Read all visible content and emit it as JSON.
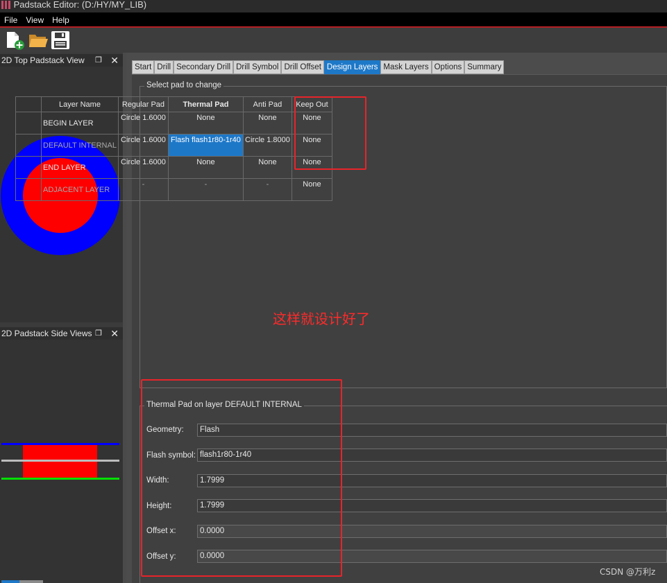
{
  "window": {
    "title": "Padstack Editor:  (D:/HY/MY_LIB)"
  },
  "menu": [
    "File",
    "View",
    "Help"
  ],
  "toolbar": {
    "icons": [
      "new-file-icon",
      "open-folder-icon",
      "save-icon"
    ]
  },
  "panels": {
    "top_view": {
      "title": "2D Top Padstack View"
    },
    "side_views": {
      "title": "2D Padstack Side Views"
    }
  },
  "tabs": [
    "Start",
    "Drill",
    "Secondary Drill",
    "Drill Symbol",
    "Drill Offset",
    "Design Layers",
    "Mask Layers",
    "Options",
    "Summary"
  ],
  "active_tab": "Design Layers",
  "pad_table": {
    "group_title": "Select pad to change",
    "columns": [
      "Layer Name",
      "Regular Pad",
      "Thermal Pad",
      "Anti Pad",
      "Keep Out"
    ],
    "rows": [
      {
        "layer": "BEGIN LAYER",
        "regular": "Circle 1.6000",
        "thermal": "None",
        "anti": "None",
        "keepout": "None"
      },
      {
        "layer": "DEFAULT INTERNAL",
        "regular": "Circle 1.6000",
        "thermal": "Flash flash1r80-1r40",
        "anti": "Circle 1.8000",
        "keepout": "None"
      },
      {
        "layer": "END LAYER",
        "regular": "Circle 1.6000",
        "thermal": "None",
        "anti": "None",
        "keepout": "None"
      },
      {
        "layer": "ADJACENT LAYER",
        "regular": "-",
        "thermal": "-",
        "anti": "-",
        "keepout": "None"
      }
    ]
  },
  "annotation": "这样就设计好了",
  "pad_form": {
    "group_title": "Thermal Pad on layer DEFAULT INTERNAL",
    "fields": [
      {
        "label": "Geometry:",
        "value": "Flash"
      },
      {
        "label": "Flash symbol:",
        "value": "flash1r80-1r40"
      },
      {
        "label": "Width:",
        "value": "1.7999"
      },
      {
        "label": "Height:",
        "value": "1.7999"
      },
      {
        "label": "Offset x:",
        "value": "0.0000"
      },
      {
        "label": "Offset y:",
        "value": "0.0000"
      }
    ]
  },
  "watermark": "CSDN @万利z",
  "colors": {
    "pad_outer": "#0000ff",
    "pad_inner": "#ff0000",
    "highlight_box": "#e8242a",
    "selected_cell": "#1e78c8",
    "side_top_line": "#0000ff",
    "side_mid_line": "#bdbdbd",
    "side_bottom_line": "#00e000"
  }
}
